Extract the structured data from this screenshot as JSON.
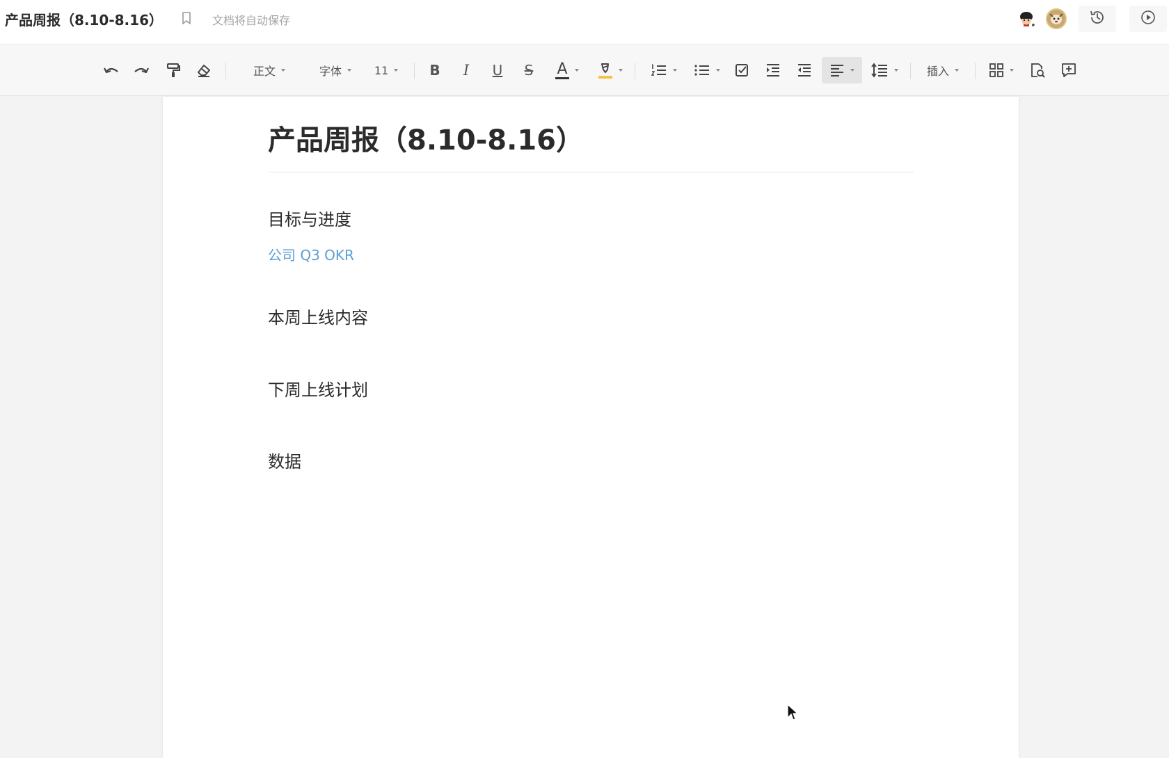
{
  "titlebar": {
    "doc_title": "产品周报（8.10-8.16）",
    "autosave": "文档将自动保存",
    "icons": [
      "bookmark-icon",
      "history-icon",
      "present-icon"
    ]
  },
  "toolbar": {
    "style_label": "正文",
    "font_label": "字体",
    "size_label": "11",
    "bold_label": "B",
    "italic_label": "I",
    "underline_label": "U",
    "strike_label": "S",
    "font_color_label": "A",
    "insert_label": "插入",
    "colors": {
      "font_color_underline": "#333333",
      "highlight_underline": "#f5c342"
    }
  },
  "document": {
    "title": "产品周报（8.10-8.16）",
    "sections": [
      {
        "heading": "目标与进度"
      },
      {
        "heading": "本周上线内容"
      },
      {
        "heading": "下周上线计划"
      },
      {
        "heading": "数据"
      }
    ],
    "link_text": "公司 Q3 OKR",
    "link_color": "#5a9fd4"
  }
}
